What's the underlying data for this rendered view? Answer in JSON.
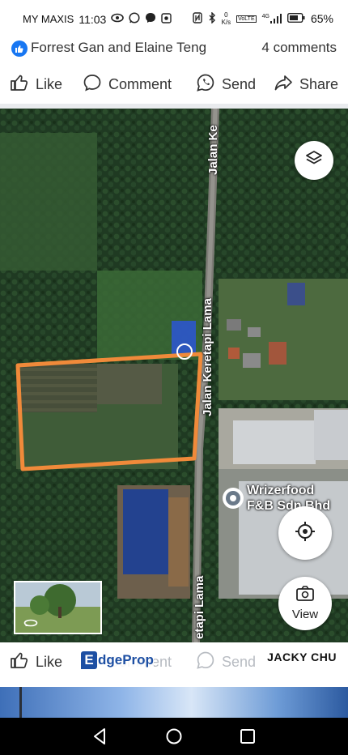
{
  "status_bar": {
    "carrier": "MY MAXIS",
    "time": "11:03",
    "network_speed_value": "0",
    "network_speed_unit": "K/s",
    "volte": "VoLTE",
    "network_type": "4G",
    "battery": "65%"
  },
  "post": {
    "reactors": "Forrest Gan and Elaine Teng",
    "comments_count": "4 comments"
  },
  "actions": {
    "like": "Like",
    "comment": "Comment",
    "send": "Send",
    "share": "Share"
  },
  "map": {
    "road_label_top": "Jalan Ke",
    "road_label_middle": "Jalan Keretapi Lama",
    "road_label_bottom": "etapi Lama",
    "place_line1": "Wrizerfood",
    "place_line2": "F&B Sdn Bhd",
    "view_button": "View",
    "highlight_color": "#f08a3a"
  },
  "overlay": {
    "brand_first": "E",
    "brand_rest": "dgeProp",
    "agent": "JACKY CHU"
  },
  "colors": {
    "facebook_blue": "#1877f2",
    "edgeprop_blue": "#1d4fa3"
  }
}
